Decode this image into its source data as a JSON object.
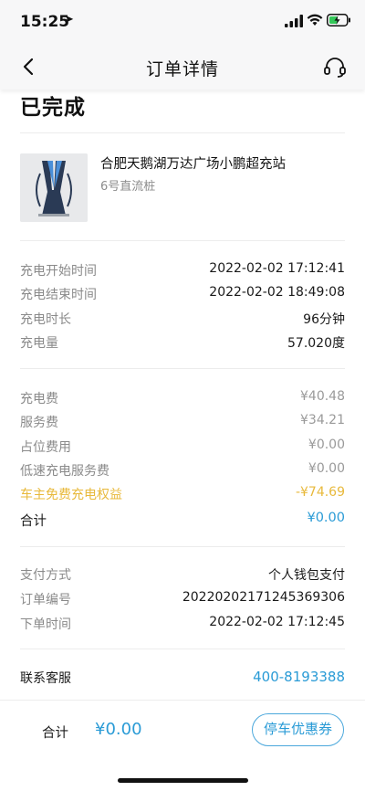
{
  "status_bar": {
    "time": "15:25",
    "location_icon": "location-arrow-icon",
    "signal_icon": "cellular-signal-icon",
    "wifi_icon": "wifi-icon",
    "battery_icon": "battery-charging-icon"
  },
  "nav": {
    "title": "订单详情",
    "back_icon": "chevron-left-icon",
    "service_icon": "headset-icon"
  },
  "order_status": "已完成",
  "station": {
    "name": "合肥天鹅湖万达广场小鹏超充站",
    "pile": "6号直流桩"
  },
  "charging": [
    {
      "label": "充电开始时间",
      "value": "2022-02-02 17:12:41"
    },
    {
      "label": "充电结束时间",
      "value": "2022-02-02 18:49:08"
    },
    {
      "label": "充电时长",
      "value": "96分钟"
    },
    {
      "label": "充电量",
      "value": "57.020度"
    }
  ],
  "fees": [
    {
      "label": "充电费",
      "value": "¥40.48"
    },
    {
      "label": "服务费",
      "value": "¥34.21"
    },
    {
      "label": "占位费用",
      "value": "¥0.00"
    },
    {
      "label": "低速充电服务费",
      "value": "¥0.00"
    }
  ],
  "owner_perk": {
    "label": "车主免费充电权益",
    "value": "-¥74.69"
  },
  "total": {
    "label": "合计",
    "value": "¥0.00"
  },
  "payment": [
    {
      "label": "支付方式",
      "value": "个人钱包支付"
    },
    {
      "label": "订单编号",
      "value": "20220202171245369306"
    },
    {
      "label": "下单时间",
      "value": "2022-02-02 17:12:45"
    }
  ],
  "contact": {
    "label": "联系客服",
    "phone": "400-8193388"
  },
  "bottom": {
    "total_label": "合计",
    "total_amount": "¥0.00",
    "coupon_button": "停车优惠券"
  },
  "colors": {
    "accent_blue": "#2a9bd6",
    "perk_gold": "#e8b93b",
    "label_gray": "#8a8a8a"
  }
}
